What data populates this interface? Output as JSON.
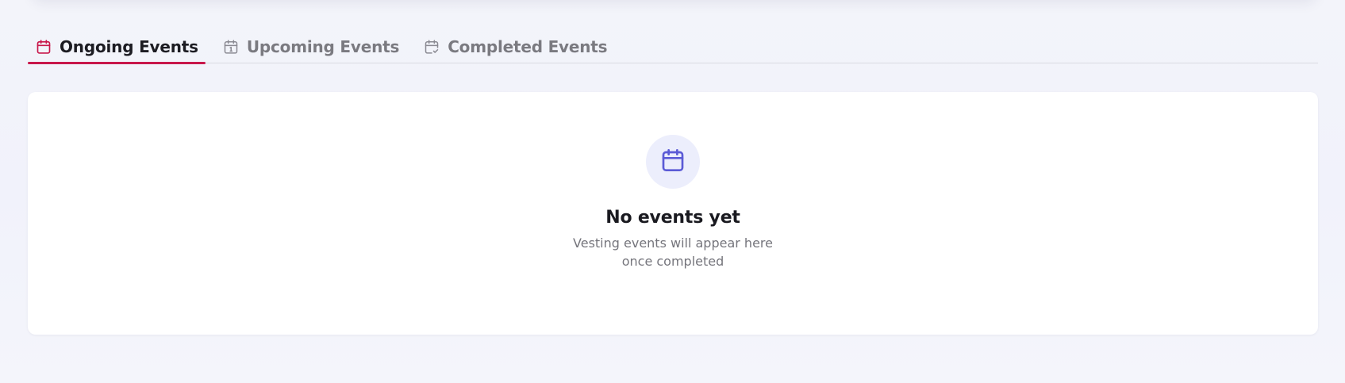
{
  "tabs": [
    {
      "label": "Ongoing Events",
      "icon": "calendar-icon",
      "active": true
    },
    {
      "label": "Upcoming Events",
      "icon": "calendar-day-icon",
      "active": false
    },
    {
      "label": "Completed Events",
      "icon": "calendar-check-icon",
      "active": false
    }
  ],
  "empty_state": {
    "icon": "calendar-icon",
    "title": "No events yet",
    "subtitle": "Vesting events will appear here once completed"
  },
  "colors": {
    "accent": "#c8174a",
    "icon_primary": "#5b5bd6",
    "icon_bg": "#eceefc",
    "inactive_text": "#7a7a80"
  }
}
